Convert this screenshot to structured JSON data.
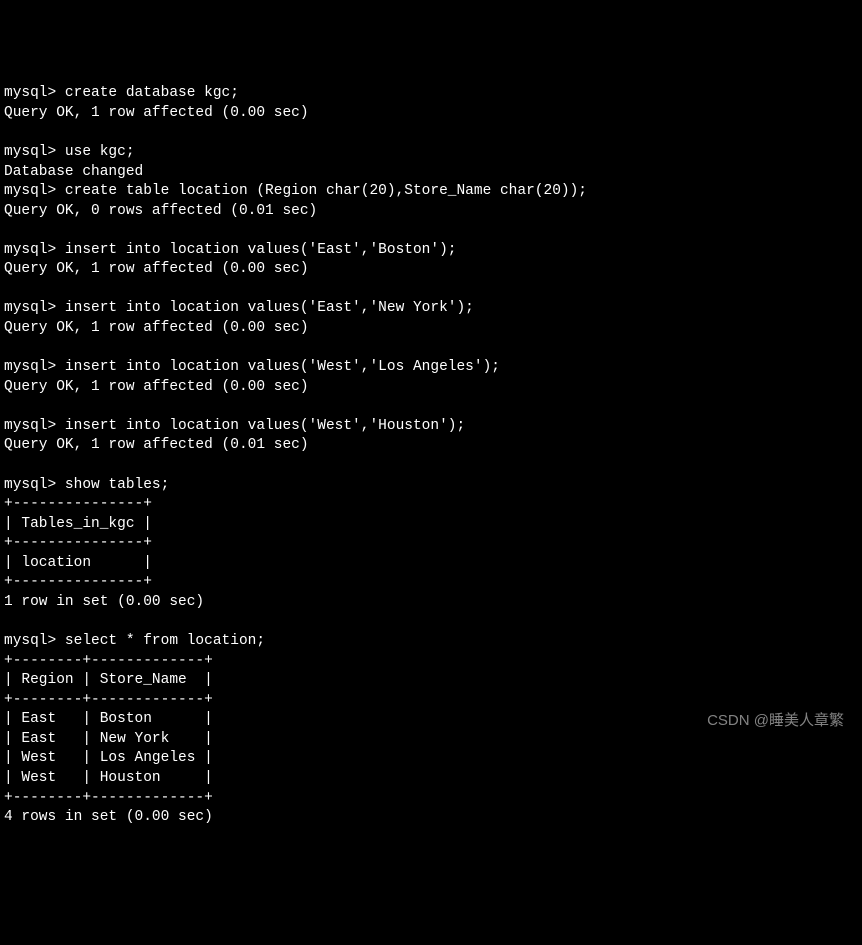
{
  "terminal": {
    "lines": [
      "mysql> create database kgc;",
      "Query OK, 1 row affected (0.00 sec)",
      "",
      "mysql> use kgc;",
      "Database changed",
      "mysql> create table location (Region char(20),Store_Name char(20));",
      "Query OK, 0 rows affected (0.01 sec)",
      "",
      "mysql> insert into location values('East','Boston');",
      "Query OK, 1 row affected (0.00 sec)",
      "",
      "mysql> insert into location values('East','New York');",
      "Query OK, 1 row affected (0.00 sec)",
      "",
      "mysql> insert into location values('West','Los Angeles');",
      "Query OK, 1 row affected (0.00 sec)",
      "",
      "mysql> insert into location values('West','Houston');",
      "Query OK, 1 row affected (0.01 sec)",
      "",
      "mysql> show tables;",
      "+---------------+",
      "| Tables_in_kgc |",
      "+---------------+",
      "| location      |",
      "+---------------+",
      "1 row in set (0.00 sec)",
      "",
      "mysql> select * from location;",
      "+--------+-------------+",
      "| Region | Store_Name  |",
      "+--------+-------------+",
      "| East   | Boston      |",
      "| East   | New York    |",
      "| West   | Los Angeles |",
      "| West   | Houston     |",
      "+--------+-------------+",
      "4 rows in set (0.00 sec)"
    ]
  },
  "watermark": "CSDN @睡美人章繁"
}
